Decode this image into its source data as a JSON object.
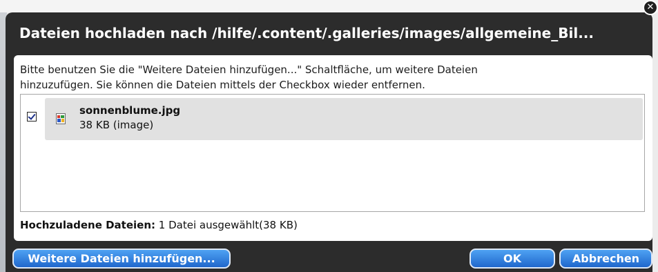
{
  "dialog": {
    "title": "Dateien hochladen nach /hilfe/.content/.galleries/images/allgemeine_Bil...",
    "close_glyph": "✕",
    "intro_line1": "Bitte benutzen Sie die \"Weitere Dateien hinzufügen...\" Schaltfläche, um weitere Dateien",
    "intro_line2": "hinzuzufügen. Sie können die Dateien mittels der Checkbox wieder entfernen.",
    "files": [
      {
        "name": "sonnenblume.jpg",
        "size": "38 KB (image)",
        "checked": true,
        "icon": "image-file-icon"
      }
    ],
    "summary_label": "Hochzuladene Dateien:",
    "summary_value": "1 Datei ausgewählt(38 KB)"
  },
  "buttons": {
    "add": "Weitere Dateien hinzufügen...",
    "ok": "OK",
    "cancel": "Abbrechen"
  },
  "colors": {
    "dialog_bg": "#2c2c2c",
    "button_top": "#4fa2f3",
    "button_bottom": "#1f67cc",
    "file_row_bg": "#e1e1e1"
  }
}
